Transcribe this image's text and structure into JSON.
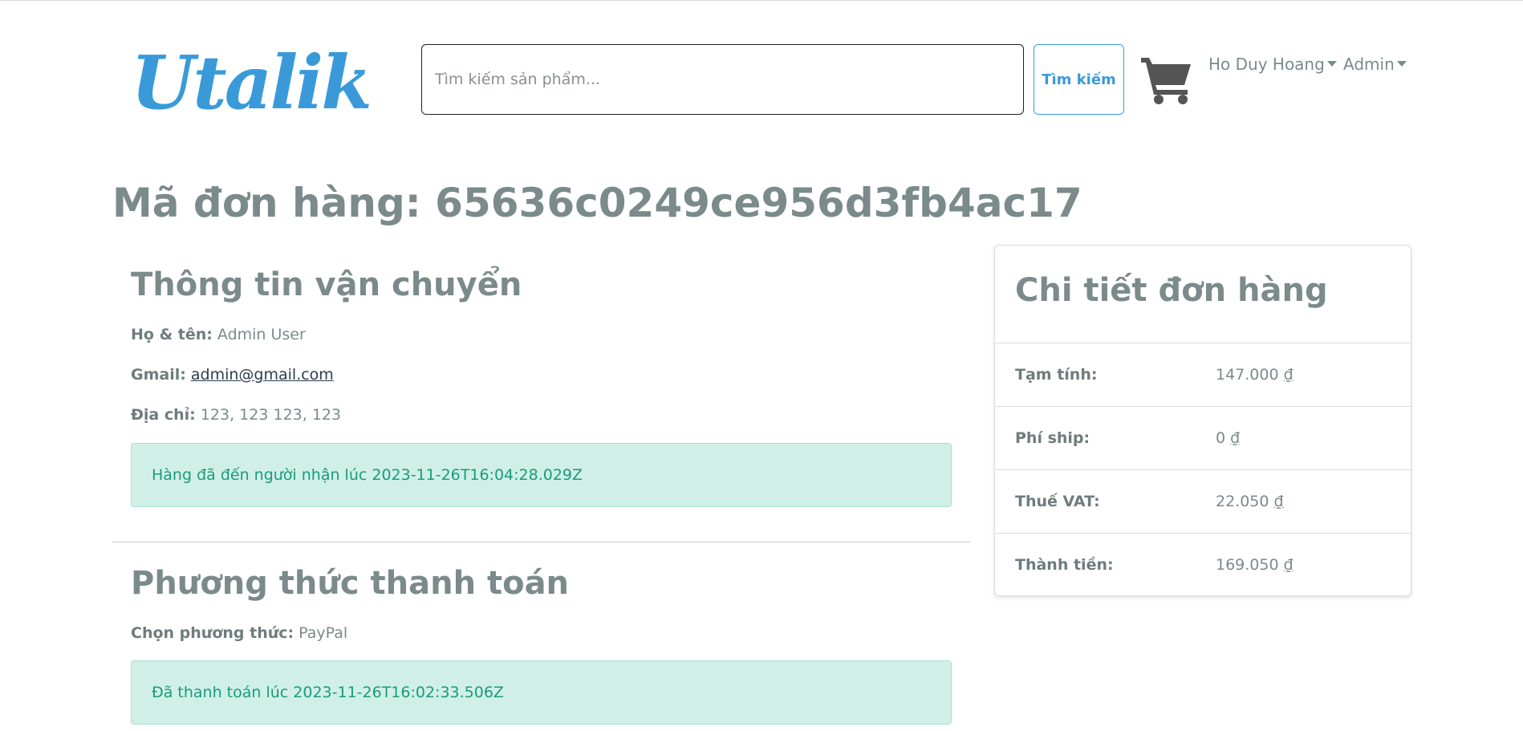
{
  "header": {
    "logo_text": "Utalik",
    "search": {
      "placeholder": "Tìm kiếm sản phẩm...",
      "value": "",
      "button_label": "Tìm kiếm"
    },
    "cart_icon": "shopping-cart-icon",
    "user_menu_label": "Ho Duy Hoang",
    "admin_menu_label": "Admin"
  },
  "order": {
    "title": "Mã đơn hàng: 65636c0249ce956d3fb4ac17"
  },
  "shipping": {
    "heading": "Thông tin vận chuyển",
    "name_label": "Họ & tên:",
    "name_value": "Admin User",
    "email_label": "Gmail:",
    "email_value": "admin@gmail.com",
    "address_label": "Địa chỉ:",
    "address_value": "123, 123 123, 123",
    "delivered_alert": "Hàng đã đến người nhận lúc 2023-11-26T16:04:28.029Z"
  },
  "payment": {
    "heading": "Phương thức thanh toán",
    "method_label": "Chọn phương thức:",
    "method_value": "PayPal",
    "paid_alert": "Đã thanh toán lúc 2023-11-26T16:02:33.506Z"
  },
  "summary": {
    "heading": "Chi tiết đơn hàng",
    "currency_symbol": "₫",
    "rows": [
      {
        "label": "Tạm tính:",
        "value": "147.000"
      },
      {
        "label": "Phí ship:",
        "value": "0"
      },
      {
        "label": "Thuế VAT:",
        "value": "22.050"
      },
      {
        "label": "Thành tiền:",
        "value": "169.050"
      }
    ]
  },
  "colors": {
    "brand": "#3a9ad9",
    "text_muted": "#7b8a8b",
    "alert_bg": "#d0f0e7",
    "alert_text": "#1a9b7b"
  }
}
